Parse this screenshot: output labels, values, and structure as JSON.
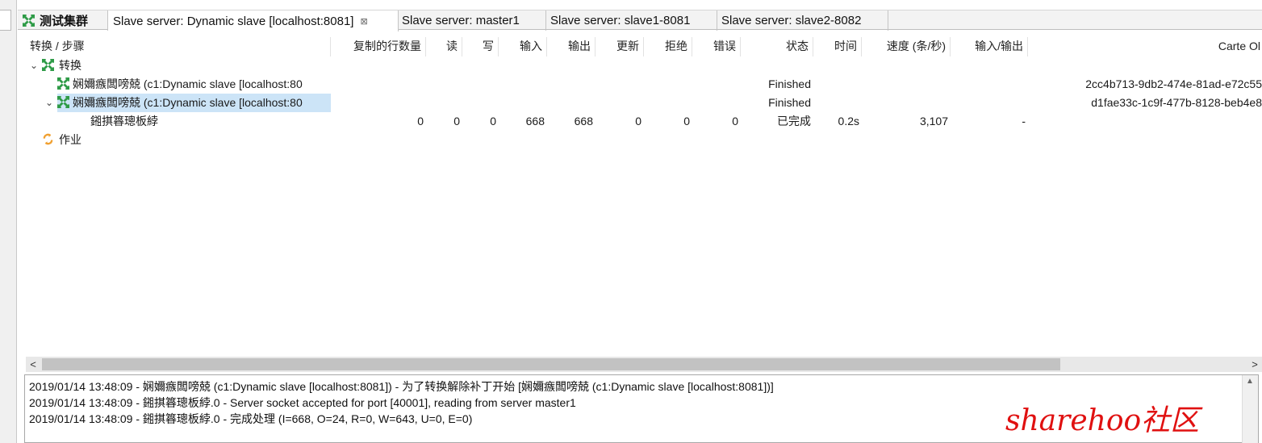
{
  "tabs": [
    {
      "label": "测试集群",
      "active": false
    },
    {
      "label": "Slave server: Dynamic slave [localhost:8081]",
      "active": true,
      "close": "⊠"
    },
    {
      "label": "Slave server: master1",
      "active": false
    },
    {
      "label": "Slave server: slave1-8081",
      "active": false
    },
    {
      "label": "Slave server: slave2-8082",
      "active": false
    }
  ],
  "columns": {
    "name": "转换 / 步骤",
    "copies": "复制的行数量",
    "read": "读",
    "write": "写",
    "input": "输入",
    "output": "输出",
    "update": "更新",
    "rejected": "拒绝",
    "errors": "错误",
    "status": "状态",
    "time": "时间",
    "speed": "速度 (条/秒)",
    "io": "输入/输出",
    "carte": "Carte Ol"
  },
  "tree": {
    "trans_label": "转换",
    "trans_toggle": "⌄",
    "trans1": {
      "name": "娴嬭瘯闆嗙兢 (c1:Dynamic slave [localhost:80",
      "status": "Finished",
      "carte": "2cc4b713-9db2-474e-81ad-e72c55"
    },
    "trans2": {
      "toggle": "⌄",
      "name": "娴嬭瘯闆嗙兢 (c1:Dynamic slave [localhost:80",
      "status": "Finished",
      "carte": "d1fae33c-1c9f-477b-8128-beb4e8"
    },
    "step": {
      "name": "鎺掑簭璁板綍",
      "copies": "0",
      "read": "0",
      "write": "0",
      "input": "668",
      "output": "668",
      "update": "0",
      "rejected": "0",
      "errors": "0",
      "status": "已完成",
      "time": "0.2s",
      "speed": "3,107",
      "io": "-"
    },
    "job_label": "作业"
  },
  "scrollbar": {
    "left": "<",
    "right": ">"
  },
  "log": [
    "2019/01/14 13:48:09 - 娴嬭瘯闆嗙兢 (c1:Dynamic slave [localhost:8081]) - 为了转换解除补丁开始  [娴嬭瘯闆嗙兢 (c1:Dynamic slave [localhost:8081])]",
    "2019/01/14 13:48:09 - 鎺掑簭璁板綍.0 - Server socket accepted for port [40001], reading from server master1",
    "2019/01/14 13:48:09 - 鎺掑簭璁板綍.0 - 完成处理 (I=668, O=24, R=0, W=643, U=0, E=0)"
  ],
  "watermark": "sharehoo社区",
  "colors": {
    "accent_green": "#2e9b47",
    "job_orange": "#f0a030",
    "selection": "#cce4f7",
    "watermark": "#e01010"
  }
}
